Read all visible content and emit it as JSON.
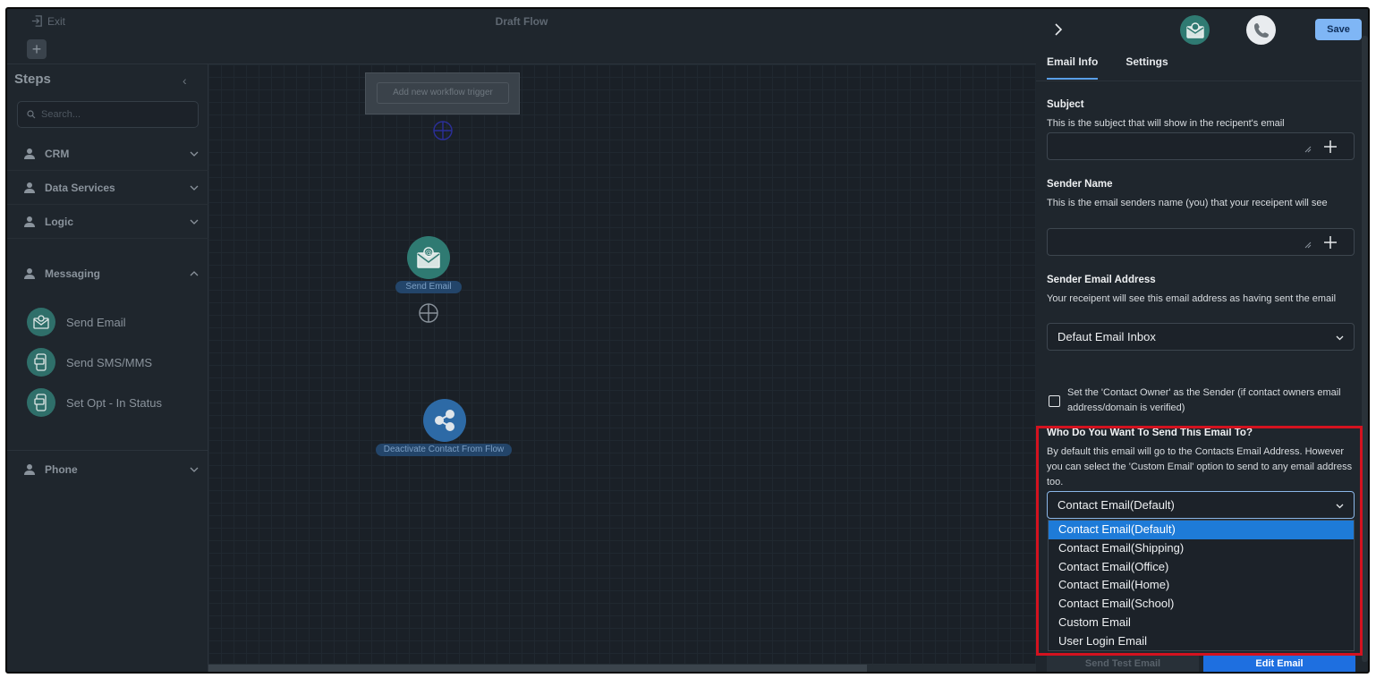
{
  "topbar": {
    "exit_label": "Exit",
    "flow_title": "Draft Flow",
    "add_symbol": "+"
  },
  "sidebar": {
    "title": "Steps",
    "collapse_symbol": "‹",
    "search_placeholder": "Search...",
    "categories": [
      {
        "label": "CRM",
        "expanded": false
      },
      {
        "label": "Data Services",
        "expanded": false
      },
      {
        "label": "Logic",
        "expanded": false
      },
      {
        "label": "Messaging",
        "expanded": true
      },
      {
        "label": "Phone",
        "expanded": false
      }
    ],
    "messaging_items": [
      {
        "label": "Send Email",
        "icon": "email-icon"
      },
      {
        "label": "Send SMS/MMS",
        "icon": "sms-icon"
      },
      {
        "label": "Set Opt - In Status",
        "icon": "sms-icon"
      }
    ]
  },
  "canvas": {
    "trigger_label": "Add new workflow trigger",
    "nodes": [
      {
        "label": "Send Email",
        "icon": "email-icon"
      },
      {
        "label": "Deactivate Contact From Flow",
        "icon": "share-icon"
      }
    ]
  },
  "panel": {
    "save_label": "Save",
    "tabs": [
      {
        "label": "Email Info",
        "active": true
      },
      {
        "label": "Settings",
        "active": false
      }
    ],
    "subject": {
      "label": "Subject",
      "desc": "This is the subject that will show in the recipent's email",
      "value": ""
    },
    "sender_name": {
      "label": "Sender Name",
      "desc": "This is the email senders name (you) that your receipent will see",
      "value": ""
    },
    "sender_email": {
      "label": "Sender Email Address",
      "desc": "Your receipent will see this email address as having sent the email",
      "selected": "Defaut Email Inbox"
    },
    "contact_owner": {
      "label": "Set the 'Contact Owner' as the Sender (if contact owners email address/domain is verified)",
      "checked": false
    },
    "recipient": {
      "label": "Who Do You Want To Send This Email To?",
      "desc": "By default this email will go to the Contacts Email Address. However you can select the 'Custom Email' option to send to any email address too.",
      "selected": "Contact Email(Default)",
      "options": [
        "Contact Email(Default)",
        "Contact Email(Shipping)",
        "Contact Email(Office)",
        "Contact Email(Home)",
        "Contact Email(School)",
        "Custom Email",
        "User Login Email"
      ]
    },
    "send_test_label": "Send Test Email",
    "edit_email_label": "Edit Email"
  },
  "colors": {
    "accent": "#1e7bd8",
    "highlight": "#d4121f",
    "save": "#7fb6f5"
  }
}
